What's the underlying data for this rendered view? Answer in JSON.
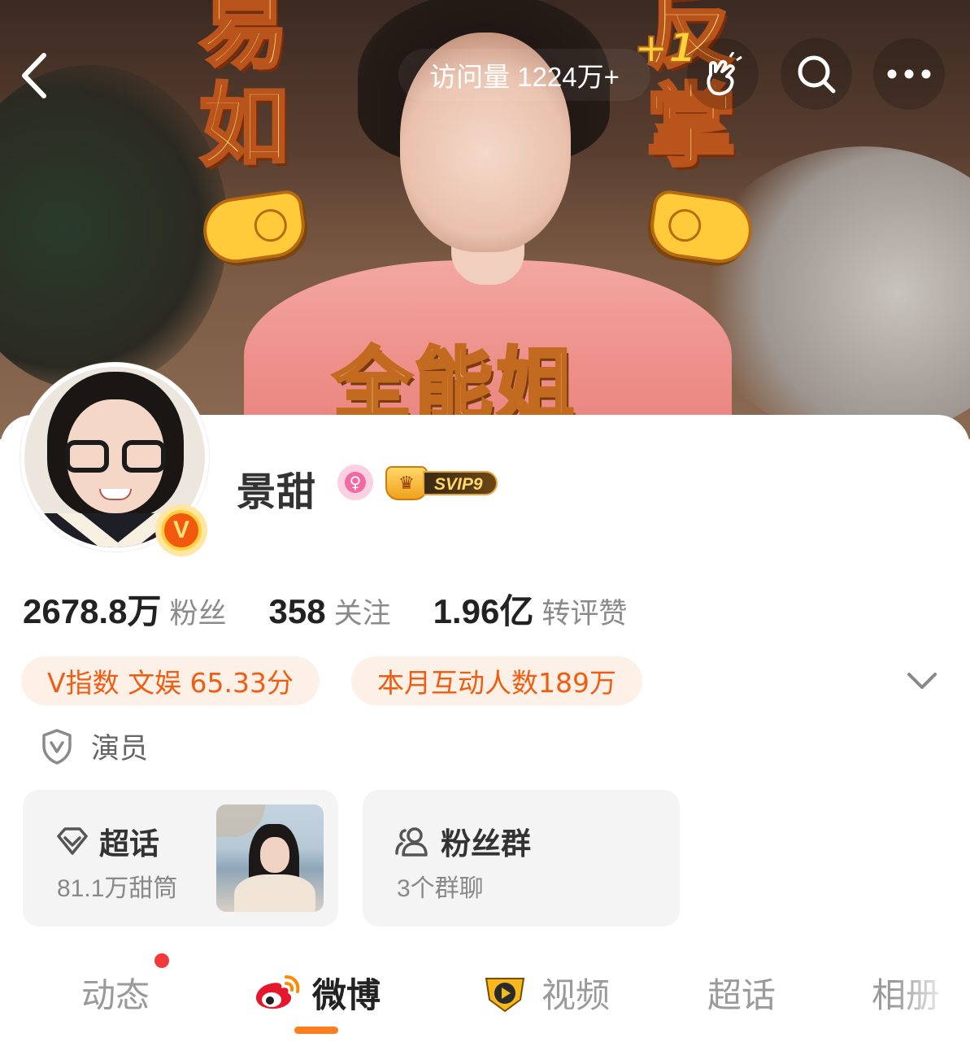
{
  "banner": {
    "chars_left": [
      "易",
      "如"
    ],
    "chars_right": [
      "反",
      "掌"
    ],
    "plus_badge": "+1",
    "caption": "全能姐"
  },
  "topbar": {
    "back_icon": "chevron-left-icon",
    "visits": "访问量 1224万+",
    "snap_icon": "finger-snap-icon",
    "search_icon": "search-icon",
    "more_icon": "more-dots-icon"
  },
  "profile": {
    "name": "景甜",
    "verified_badge": "V",
    "gender_icon": "female-icon",
    "svip_label": "SVIP9",
    "stats": [
      {
        "value": "2678.8万",
        "label": "粉丝"
      },
      {
        "value": "358",
        "label": "关注"
      },
      {
        "value": "1.96亿",
        "label": "转评赞"
      }
    ],
    "pills": {
      "vindex": "V指数  文娱 65.33分",
      "interaction": "本月互动人数189万"
    },
    "role": "演员"
  },
  "tiles": {
    "super": {
      "title": "超话",
      "subtitle": "81.1万甜筒"
    },
    "fans": {
      "title": "粉丝群",
      "subtitle": "3个群聊"
    }
  },
  "tabs": [
    {
      "label": "动态",
      "active": false,
      "has_dot": true
    },
    {
      "label": "微博",
      "active": true
    },
    {
      "label": "视频",
      "active": false
    },
    {
      "label": "超话",
      "active": false
    },
    {
      "label": "相册",
      "active": false
    }
  ],
  "colors": {
    "accent": "#f05d12",
    "pill_bg": "#fdf0e7",
    "tab_underline": "#ff7d1a",
    "notify_dot": "#f23a3a"
  }
}
